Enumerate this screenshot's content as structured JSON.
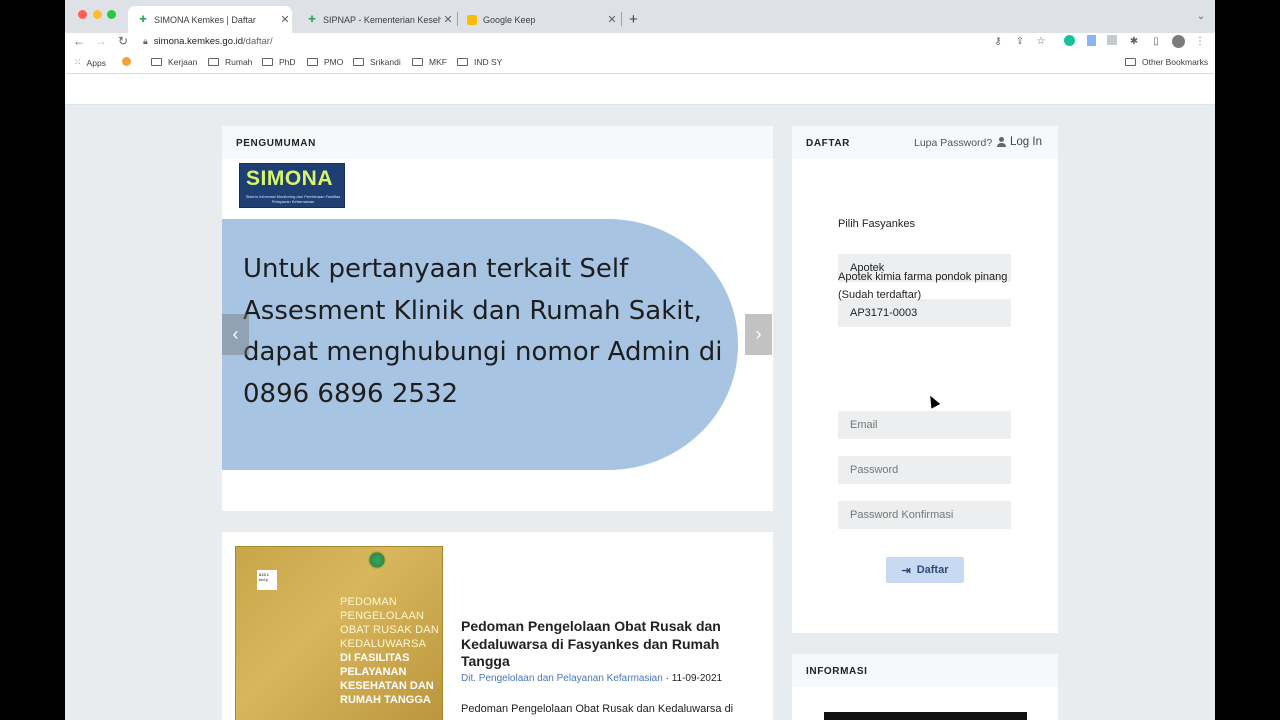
{
  "browser": {
    "tabs": [
      {
        "title": "SIMONA Kemkes | Daftar",
        "active": true
      },
      {
        "title": "SIPNAP - Kementerian Kesehatan",
        "active": false
      },
      {
        "title": "Google Keep",
        "active": false
      }
    ],
    "new_tab": "+",
    "url_host": "simona.kemkes.go.id",
    "url_path": "/daftar/",
    "bookmarks": [
      "Apps",
      "Kerjaan",
      "Rumah",
      "PhD",
      "PMO",
      "Srikandi",
      "MKF",
      "IND SY"
    ],
    "other_bookmarks": "Other Bookmarks"
  },
  "announcement": {
    "title": "PENGUMUMAN",
    "logo_text": "SIMONA",
    "logo_subtext": "Sistem Informasi Monitoring dan Pembinaan Fasilitas Pelayanan Kefarmasian",
    "slide_text": "Untuk pertanyaan terkait Self Assesment Klinik dan Rumah Sakit, dapat menghubungi nomor Admin di 0896 6896 2532",
    "prev": "‹",
    "next": "›"
  },
  "article": {
    "cover_title": "PEDOMAN PENGELOLAAN OBAT RUSAK DAN KEDALUWARSA",
    "cover_subtitle": "DI FASILITAS PELAYANAN KESEHATAN DAN RUMAH TANGGA",
    "cover_code": "615.1 Ind p",
    "title": "Pedoman Pengelolaan Obat Rusak dan Kedaluwarsa di Fasyankes dan Rumah Tangga",
    "author": "Dit. Pengelolaan dan Pelayanan Kefarmasian",
    "date": " · 11-09-2021",
    "excerpt": "Pedoman Pengelolaan Obat Rusak dan Kedaluwarsa di"
  },
  "register": {
    "title": "DAFTAR",
    "forgot": "Lupa Password?",
    "login": "Log In",
    "facility_label": "Pilih Fasyankes",
    "facility_type": "Apotek",
    "facility_code": "AP3171-0003",
    "facility_name": "Apotek kimia farma pondok pinang",
    "facility_status": "(Sudah terdaftar)",
    "email_placeholder": "Email",
    "password_placeholder": "Password",
    "confirm_placeholder": "Password Konfirmasi",
    "submit": "Daftar"
  },
  "info": {
    "title": "INFORMASI"
  }
}
